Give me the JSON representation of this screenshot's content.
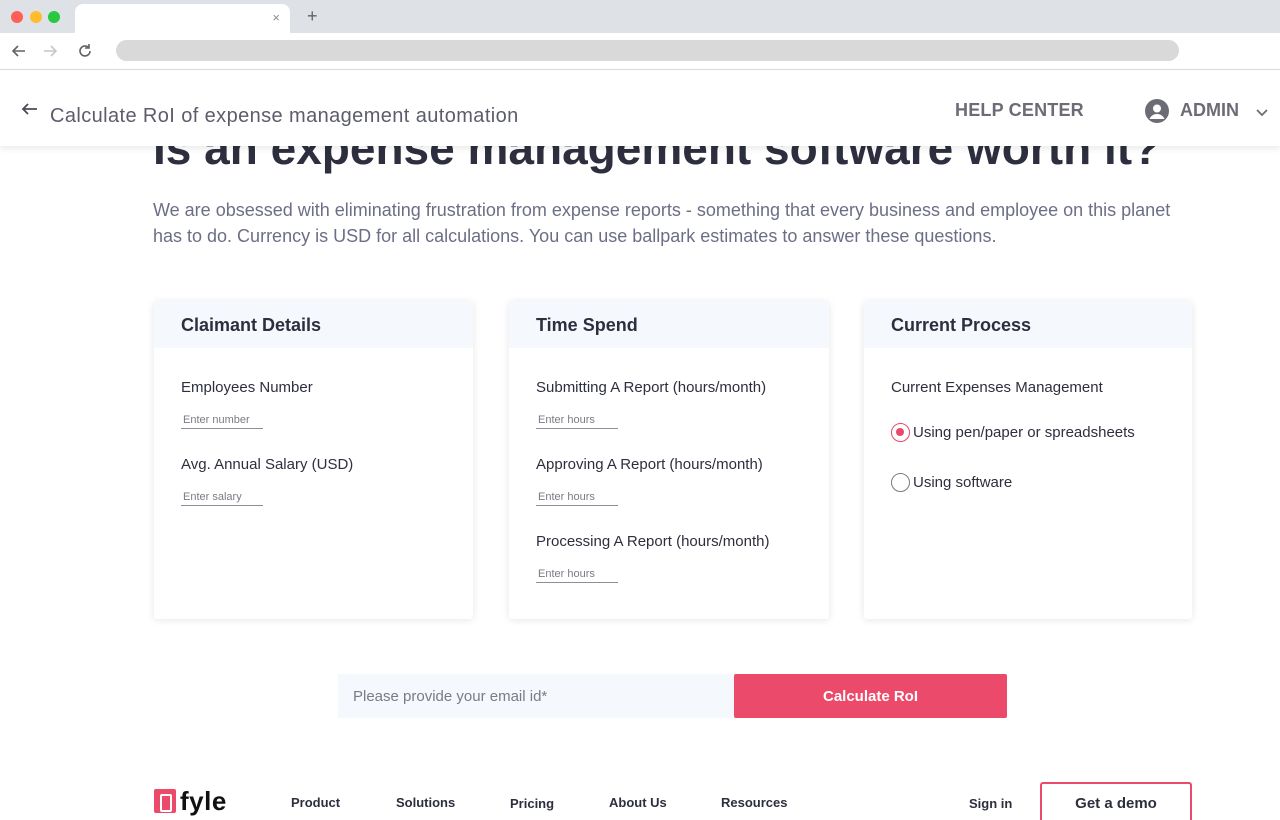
{
  "browser": {
    "tab_close": "×",
    "new_tab": "+"
  },
  "header": {
    "title": "Calculate RoI of expense management automation",
    "help_center": "HELP CENTER",
    "user": "ADMIN"
  },
  "main": {
    "heading": "Is an expense management software worth it?",
    "intro": "We are obsessed with eliminating frustration from expense reports - something that every business and employee on this planet has to do. Currency is USD for all calculations. You can use ballpark estimates to answer these questions."
  },
  "cards": {
    "claimant": {
      "title": "Claimant Details",
      "employees_label": "Employees Number",
      "employees_placeholder": "Enter number",
      "salary_label": "Avg. Annual Salary (USD)",
      "salary_placeholder": "Enter salary"
    },
    "time": {
      "title": "Time Spend",
      "submitting_label": "Submitting A Report (hours/month)",
      "approving_label": "Approving A Report (hours/month)",
      "processing_label": "Processing A Report (hours/month)",
      "hours_placeholder": "Enter hours"
    },
    "process": {
      "title": "Current Process",
      "question": "Current Expenses Management",
      "option_manual": "Using pen/paper or spreadsheets",
      "option_software": "Using software",
      "selected": "Using pen/paper or spreadsheets"
    }
  },
  "cta": {
    "email_placeholder": "Please provide your email id*",
    "button": "Calculate RoI"
  },
  "footer": {
    "logo": "fyle",
    "nav": [
      "Product",
      "Solutions",
      "Pricing",
      "About Us",
      "Resources"
    ],
    "sign_in": "Sign in",
    "demo": "Get a demo"
  },
  "colors": {
    "accent": "#eb4a6a",
    "text": "#2d2f3e",
    "card_header": "#f5f8fd"
  }
}
